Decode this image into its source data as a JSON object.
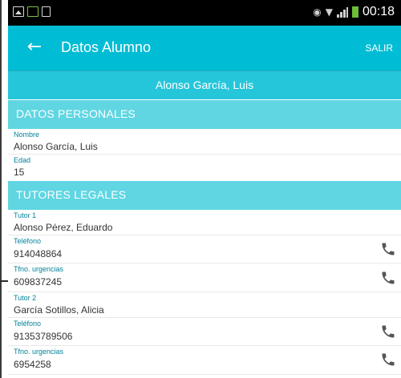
{
  "status_bar": {
    "time": "00:18",
    "icons": [
      "image-icon",
      "notification-icon",
      "document-icon",
      "eye-icon",
      "wifi-icon",
      "signal-icon",
      "battery-icon"
    ]
  },
  "app_bar": {
    "title": "Datos Alumno",
    "action": "SALIR",
    "back_icon": "arrow-back-icon"
  },
  "student": {
    "name": "Alonso García, Luis"
  },
  "sections": {
    "personal": {
      "title": "DATOS PERSONALES",
      "fields": [
        {
          "label": "Nombre",
          "value": "Alonso García, Luis"
        },
        {
          "label": "Edad",
          "value": "15"
        }
      ]
    },
    "guardians": {
      "title": "TUTORES LEGALES",
      "fields": [
        {
          "label": "Tutor 1",
          "value": "Alonso Pérez, Eduardo"
        },
        {
          "label": "Teléfono",
          "value": "914048864",
          "icon": "phone-icon"
        },
        {
          "label": "Tfno. urgencias",
          "value": "609837245",
          "icon": "phone-icon"
        },
        {
          "label": "Tutor 2",
          "value": "García Sotillos, Alicia"
        },
        {
          "label": "Teléfono",
          "value": "91353789506",
          "icon": "phone-icon"
        },
        {
          "label": "Tfno. urgencias",
          "value": "6954258",
          "icon": "phone-icon"
        }
      ]
    }
  },
  "colors": {
    "app_bar": "#00bcd4",
    "student_bar": "#26c6da",
    "section_header": "#5fd6e2",
    "label": "#00839b",
    "value": "#333333"
  }
}
